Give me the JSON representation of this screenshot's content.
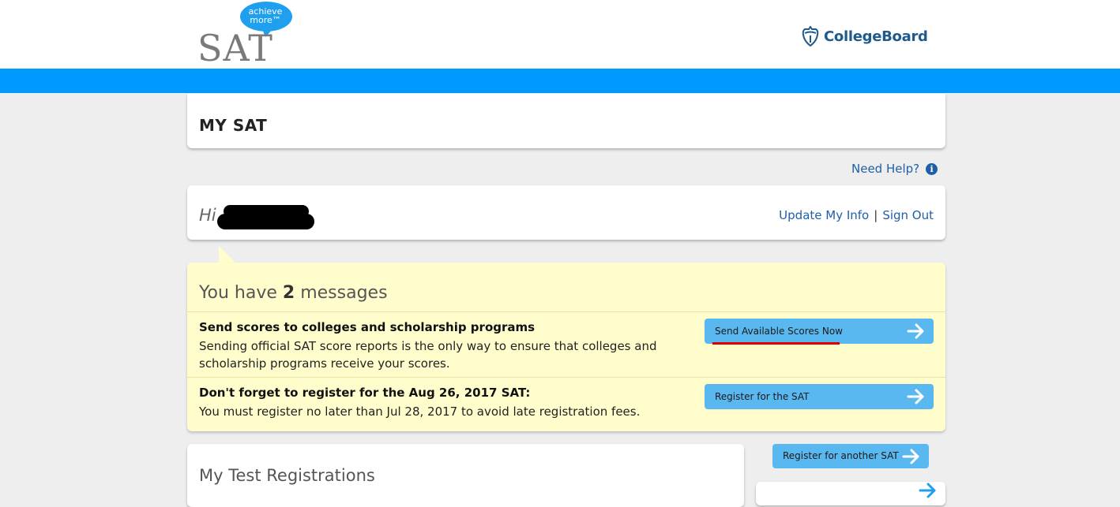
{
  "header": {
    "sat_logo_text": "SAT",
    "sat_bubble_line1": "achieve",
    "sat_bubble_line2": "more™",
    "brand_name": "CollegeBoard",
    "brand_color": "#1e5a8c",
    "bar_color": "#0099ff"
  },
  "page": {
    "title": "MY SAT",
    "help_link": "Need Help?",
    "help_icon": "info-icon"
  },
  "user": {
    "greeting": "Hi",
    "update_info_link": "Update My Info",
    "separator": "|",
    "sign_out_link": "Sign Out"
  },
  "messages": {
    "heading_prefix": "You have",
    "count": "2",
    "heading_suffix": "messages",
    "items": [
      {
        "title": "Send scores to colleges and scholarship programs",
        "body": "Sending official SAT score reports is the only way to ensure that colleges and scholarship programs receive your scores.",
        "button_label": "Send Available Scores Now"
      },
      {
        "title": "Don't forget to register for the Aug 26, 2017 SAT:",
        "body": "You must register no later than Jul 28, 2017 to avoid late registration fees.",
        "button_label": "Register for the SAT"
      }
    ]
  },
  "registrations": {
    "title": "My Test Registrations",
    "register_another_label": "Register for another SAT"
  },
  "colors": {
    "button_bg": "#5ab8f0",
    "message_bg": "#fffdcc",
    "link": "#1e5fa8",
    "highlight_underline": "#dd0000"
  }
}
